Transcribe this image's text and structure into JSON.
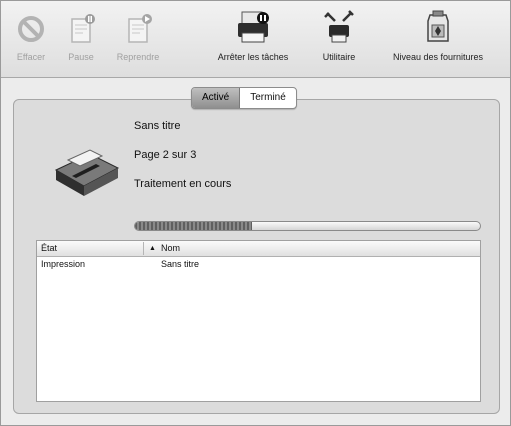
{
  "toolbar": {
    "items": [
      {
        "label": "Effacer",
        "icon": "delete-icon",
        "enabled": false
      },
      {
        "label": "Pause",
        "icon": "hold-icon",
        "enabled": false
      },
      {
        "label": "Reprendre",
        "icon": "resume-icon",
        "enabled": false
      },
      {
        "label": "Arrêter les tâches",
        "icon": "stop-jobs-icon",
        "enabled": true
      },
      {
        "label": "Utilitaire",
        "icon": "utility-icon",
        "enabled": true
      },
      {
        "label": "Niveau des fournitures",
        "icon": "supply-levels-icon",
        "enabled": true
      }
    ]
  },
  "tabs": {
    "active_label": "Activé",
    "done_label": "Terminé",
    "selected": "active"
  },
  "job": {
    "name": "Sans titre",
    "page": "Page 2 sur 3",
    "status": "Traitement en cours",
    "progress": 0.34
  },
  "table": {
    "col_status": "État",
    "sort_indicator": "▲",
    "col_name": "Nom",
    "rows": [
      {
        "status": "Impression",
        "name": "Sans titre"
      }
    ]
  }
}
